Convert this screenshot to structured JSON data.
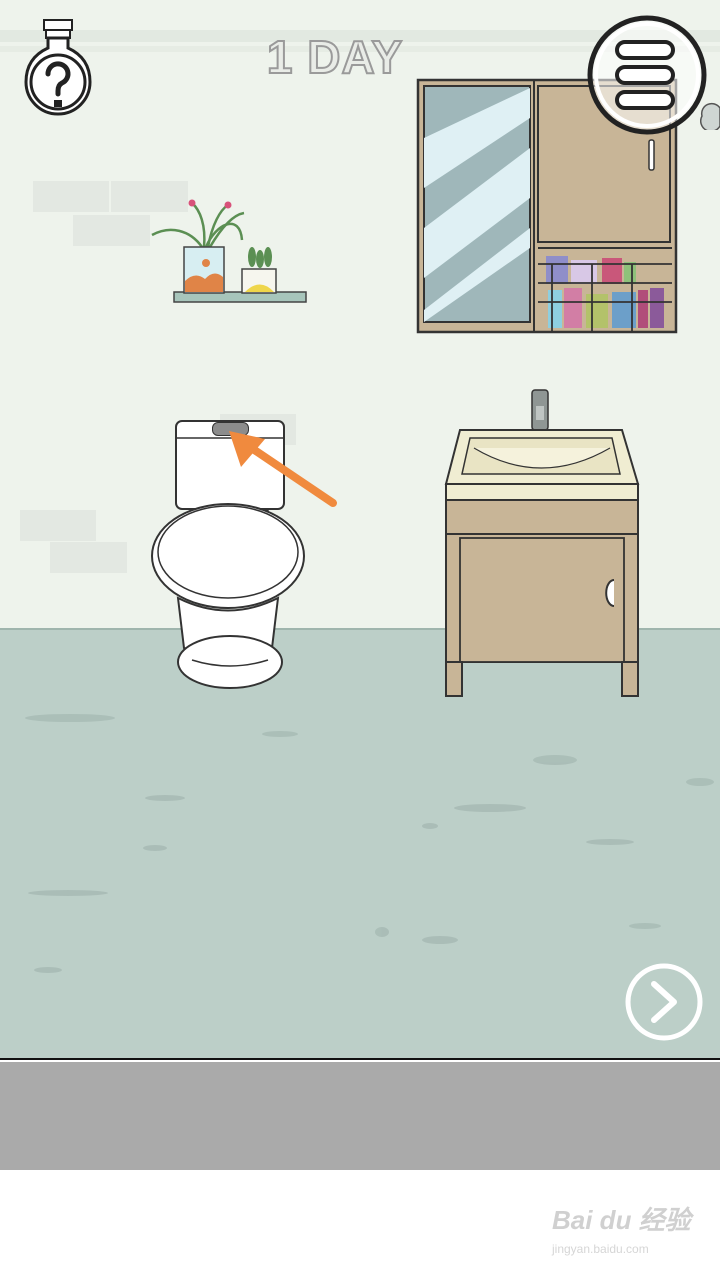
{
  "hud": {
    "day_label": "1 DAY",
    "hint_icon": "lightbulb-question-icon",
    "menu_icon": "hamburger-menu-icon",
    "next_icon": "chevron-right-icon"
  },
  "scene": {
    "room": "bathroom",
    "objects": [
      "plant-shelf",
      "mirror-cabinet",
      "toilet",
      "toilet-flush-button",
      "sink-vanity",
      "faucet"
    ],
    "hint_arrow_color": "#f08a3e"
  },
  "colors": {
    "wall": "#eef3ec",
    "floor": "#bccfc8",
    "wood": "#c8b597",
    "bottom_bar": "#aaaaaa",
    "accent_arrow": "#f08a3e"
  },
  "watermark": {
    "brand": "Bai du 经验",
    "url": "jingyan.baidu.com"
  }
}
